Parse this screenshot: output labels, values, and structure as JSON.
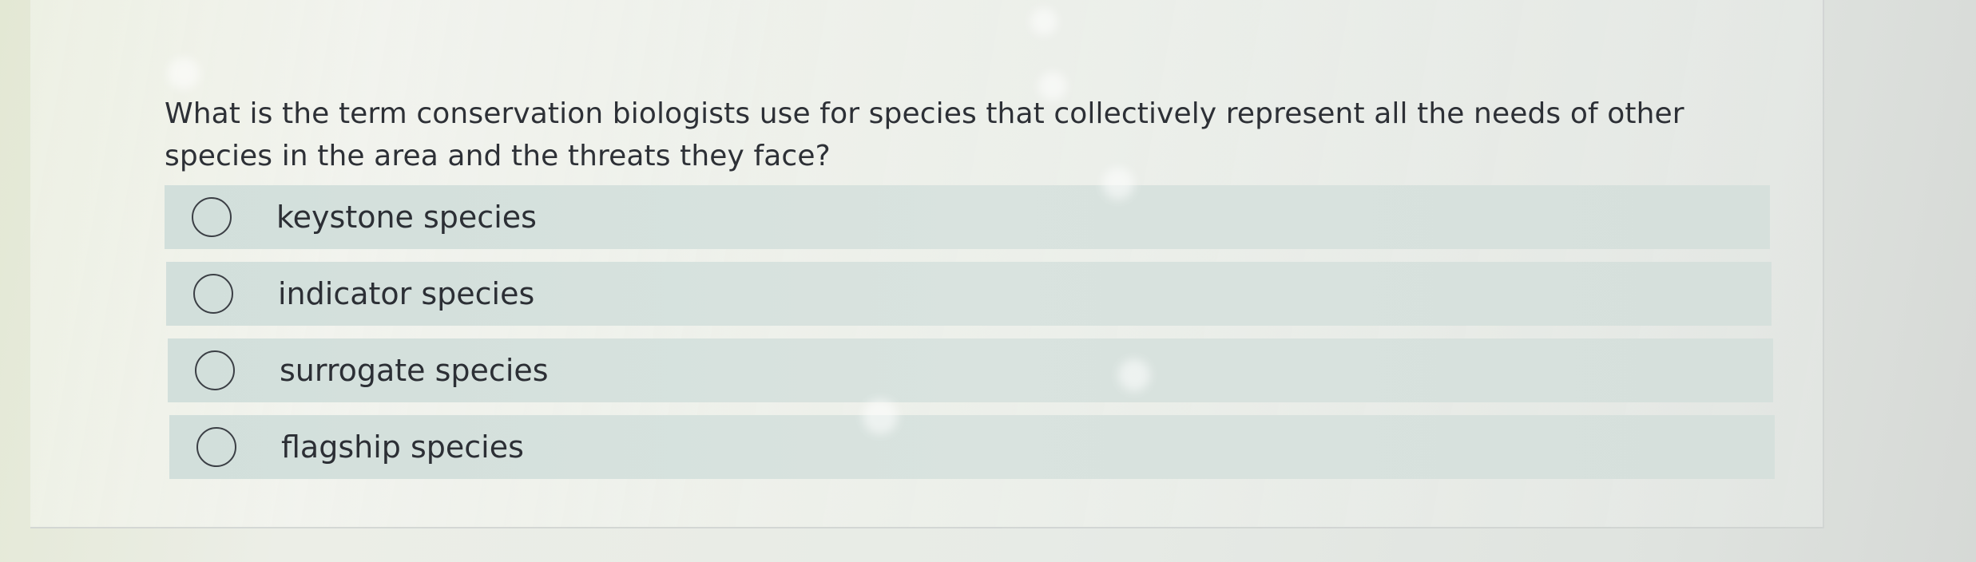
{
  "question": {
    "text": "What is the term conservation biologists use for species that collectively represent all the needs of other species in the area and the threats they face?"
  },
  "options": [
    {
      "label": "keystone species",
      "selected": false
    },
    {
      "label": "indicator species",
      "selected": false
    },
    {
      "label": "surrogate species",
      "selected": false
    },
    {
      "label": "flagship species",
      "selected": false
    }
  ],
  "colors": {
    "option_background": "#d6e0dc",
    "text": "#2c2f35",
    "radio_border": "#3b3f45"
  }
}
